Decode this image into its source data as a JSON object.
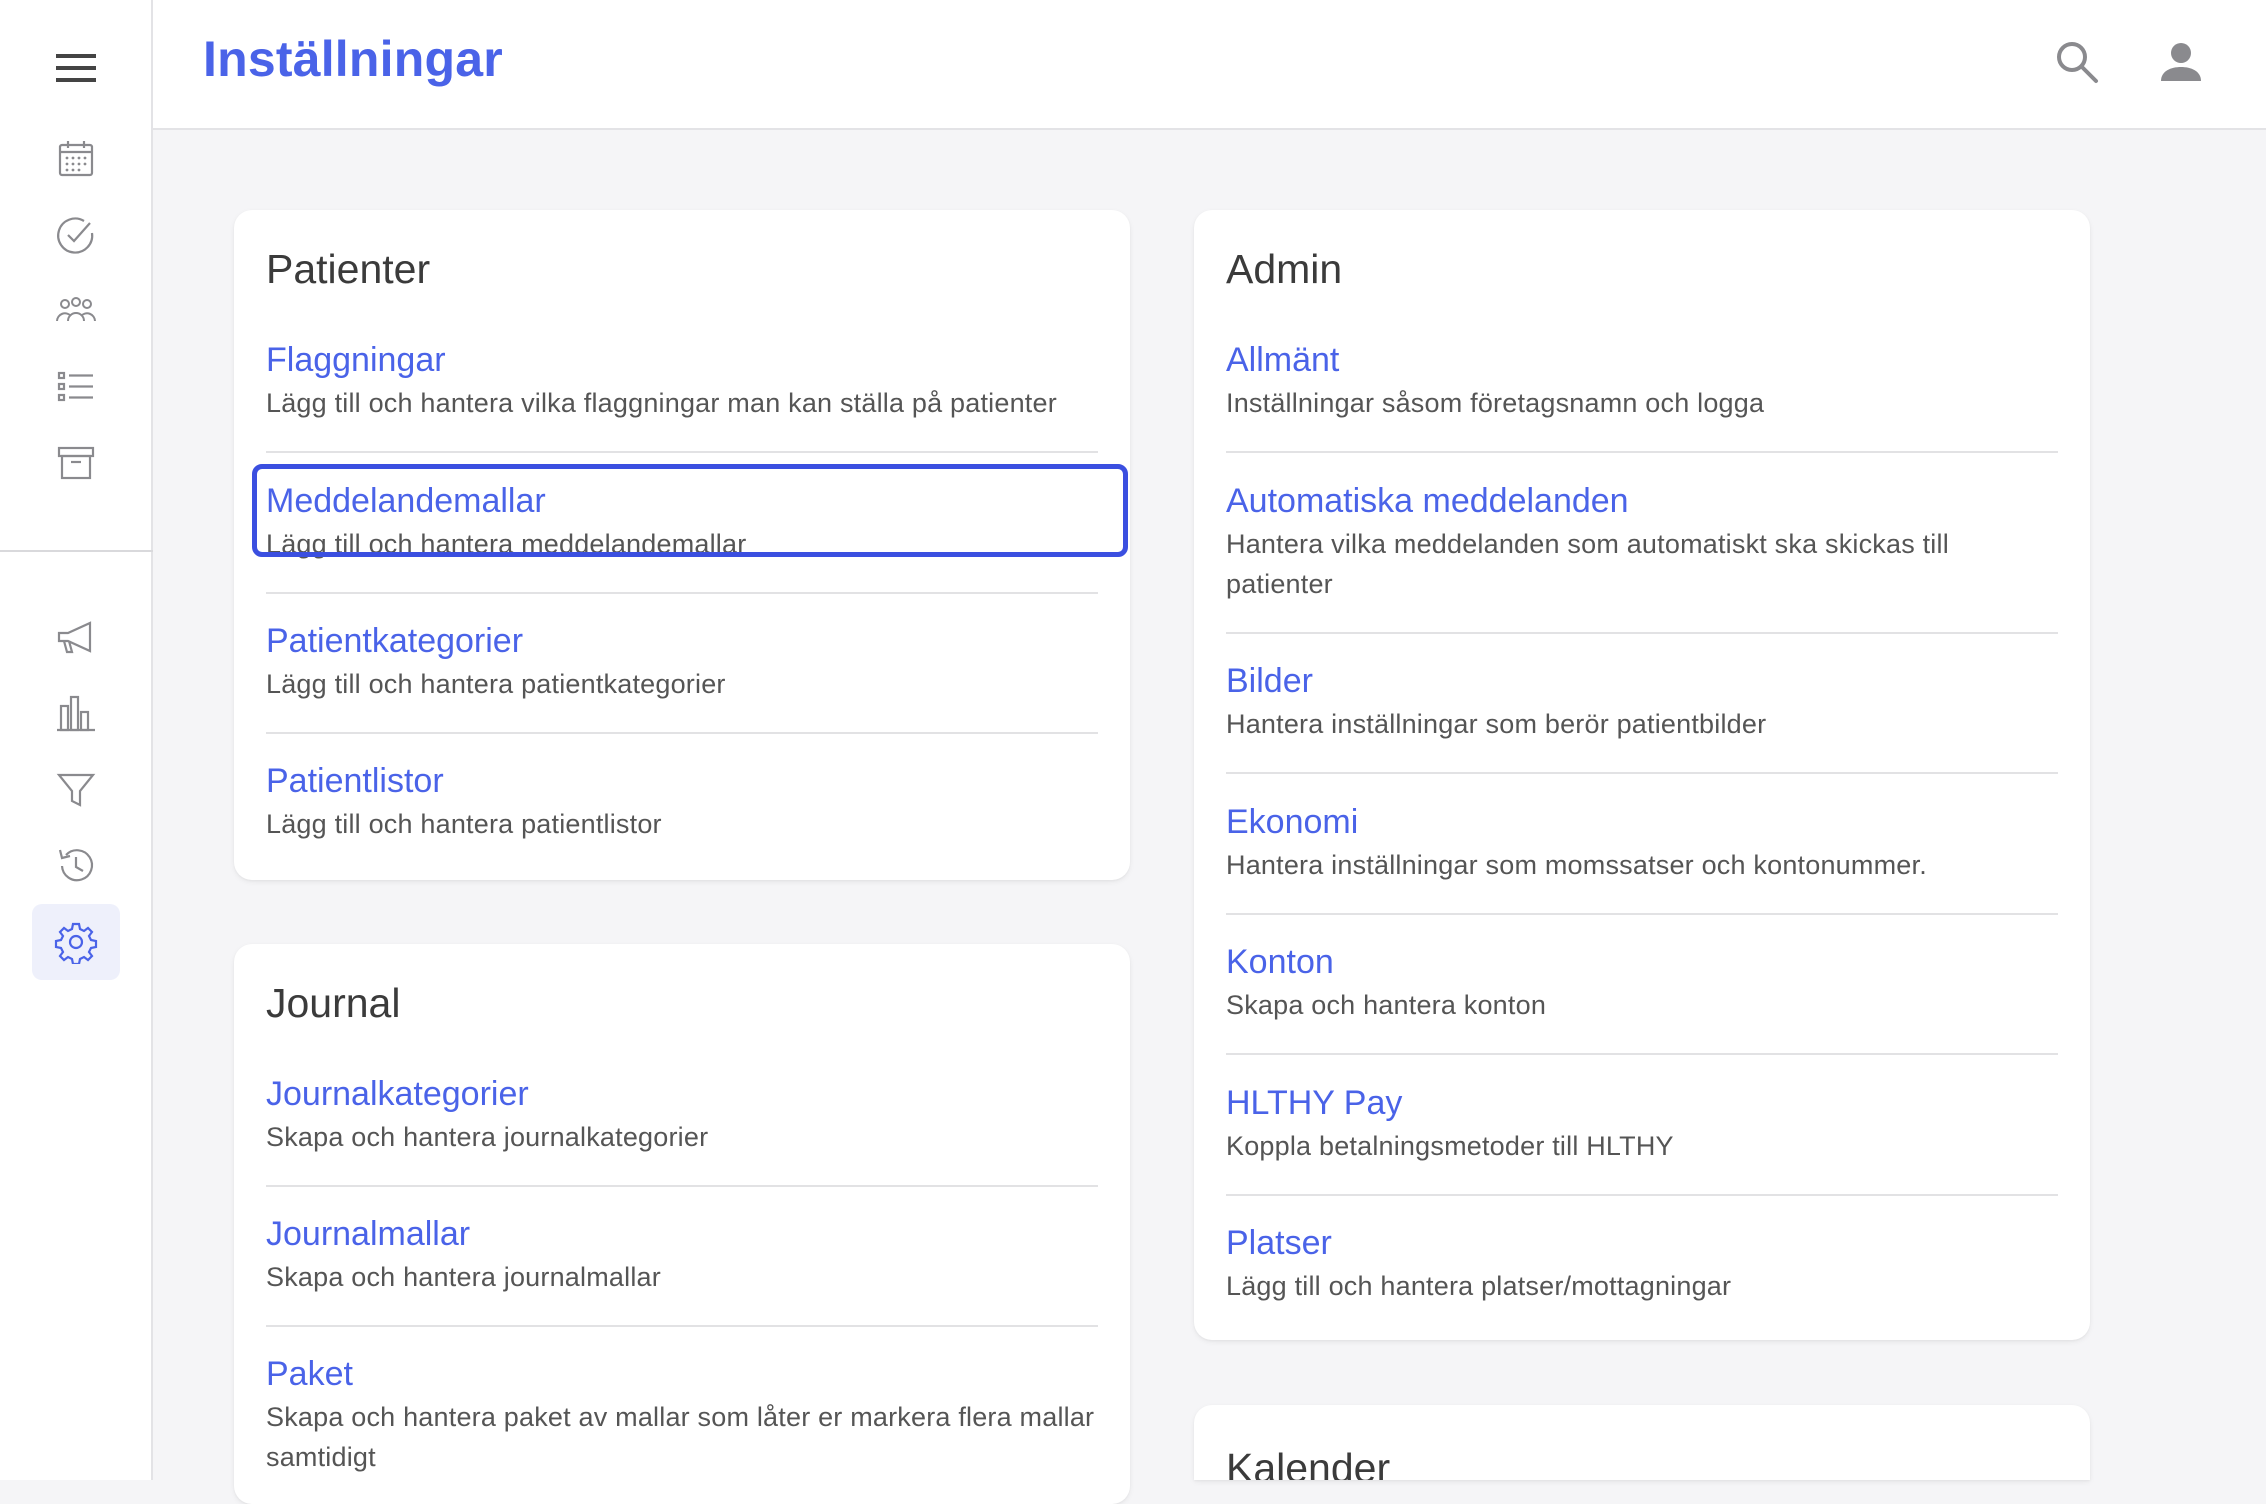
{
  "header": {
    "title": "Inställningar"
  },
  "icons": {
    "menu": "hamburger-icon",
    "search": "search-icon",
    "account": "account-icon"
  },
  "colors": {
    "accent": "#4a63e8",
    "focus": "#3b4fe0",
    "active_bg": "#eef0fb",
    "icon_gray": "#8a8a8e"
  },
  "sidebar": {
    "items": [
      {
        "name": "calendar"
      },
      {
        "name": "tasks"
      },
      {
        "name": "patients"
      },
      {
        "name": "lists"
      },
      {
        "name": "archive"
      },
      {
        "name": "campaigns"
      },
      {
        "name": "statistics"
      },
      {
        "name": "filter"
      },
      {
        "name": "history"
      },
      {
        "name": "settings",
        "active": true
      }
    ]
  },
  "patienter": {
    "title": "Patienter",
    "items": [
      {
        "title": "Flaggningar",
        "desc": "Lägg till och hantera vilka flaggningar man kan ställa på patienter"
      },
      {
        "title": "Meddelandemallar",
        "desc": "Lägg till och hantera meddelandemallar"
      },
      {
        "title": "Patientkategorier",
        "desc": "Lägg till och hantera patientkategorier"
      },
      {
        "title": "Patientlistor",
        "desc": "Lägg till och hantera patientlistor"
      }
    ]
  },
  "journal": {
    "title": "Journal",
    "items": [
      {
        "title": "Journalkategorier",
        "desc": "Skapa och hantera journalkategorier"
      },
      {
        "title": "Journalmallar",
        "desc": "Skapa och hantera journalmallar"
      },
      {
        "title": "Paket",
        "desc": "Skapa och hantera paket av mallar som låter er markera flera mallar samtidigt"
      }
    ]
  },
  "admin": {
    "title": "Admin",
    "items": [
      {
        "title": "Allmänt",
        "desc": "Inställningar såsom företagsnamn och logga"
      },
      {
        "title": "Automatiska meddelanden",
        "desc": "Hantera vilka meddelanden som automatiskt ska skickas till patienter"
      },
      {
        "title": "Bilder",
        "desc": "Hantera inställningar som berör patientbilder"
      },
      {
        "title": "Ekonomi",
        "desc": "Hantera inställningar som momssatser och kontonummer."
      },
      {
        "title": "Konton",
        "desc": "Skapa och hantera konton"
      },
      {
        "title": "HLTHY Pay",
        "desc": "Koppla betalningsmetoder till HLTHY"
      },
      {
        "title": "Platser",
        "desc": "Lägg till och hantera platser/mottagningar"
      }
    ]
  },
  "kalender": {
    "title": "Kalender"
  }
}
